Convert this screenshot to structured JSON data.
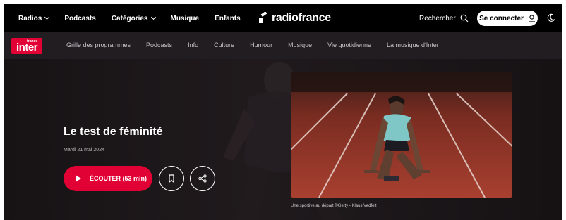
{
  "topbar": {
    "nav": [
      {
        "label": "Radios",
        "dropdown": true
      },
      {
        "label": "Podcasts",
        "dropdown": false
      },
      {
        "label": "Catégories",
        "dropdown": true
      },
      {
        "label": "Musique",
        "dropdown": false
      },
      {
        "label": "Enfants",
        "dropdown": false
      }
    ],
    "logo_text": "radiofrance",
    "search_label": "Rechercher",
    "connect_label": "Se connecter",
    "icons": {
      "search": "search-icon",
      "user": "user-icon",
      "theme": "moon-icon"
    }
  },
  "interbar": {
    "logo_small": "france",
    "logo_big": "inter",
    "nav": [
      "Grille des programmes",
      "Podcasts",
      "Info",
      "Culture",
      "Humour",
      "Musique",
      "Vie quotidienne",
      "La musique d'Inter"
    ]
  },
  "hero": {
    "title": "Le test de féminité",
    "date": "Mardi 21 mai 2024",
    "listen_label": "ÉCOUTER (53 min)",
    "caption": "Une sportive au départ ©Getty - Klaus Vedfelt"
  },
  "colors": {
    "brand_red": "#e20134",
    "topbar_bg": "#000000",
    "interbar_bg": "#221d21",
    "hero_bg": "#171315",
    "track_red": "#a03526"
  }
}
